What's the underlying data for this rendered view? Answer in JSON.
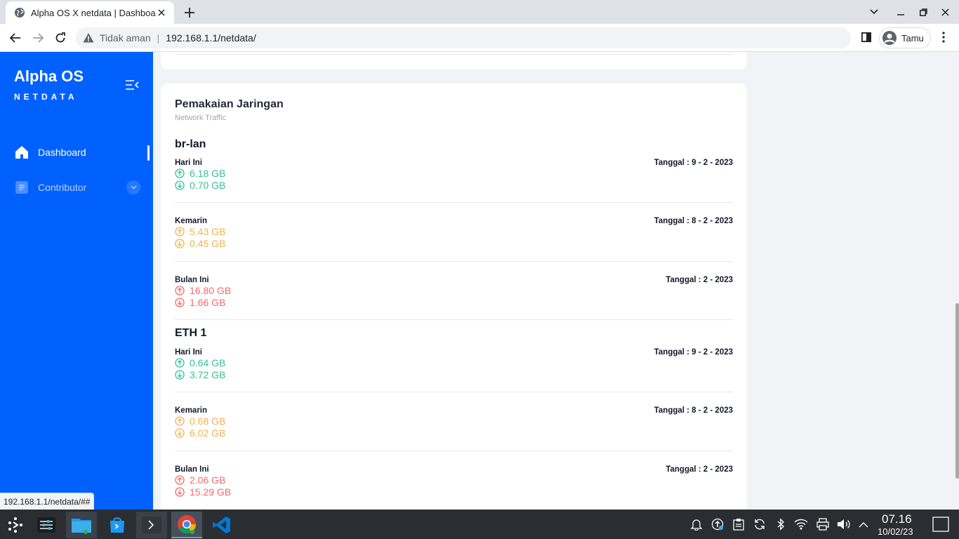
{
  "browser": {
    "tab_title": "Alpha OS X netdata | Dashboard",
    "insecure_label": "Tidak aman",
    "url": "192.168.1.1/netdata/",
    "profile_name": "Tamu",
    "status_url": "192.168.1.1/netdata/##"
  },
  "sidebar": {
    "brand_title": "Alpha OS",
    "brand_subtitle": "NETDATA",
    "items": [
      {
        "label": "Dashboard",
        "icon": "home-icon",
        "active": true
      },
      {
        "label": "Contributor",
        "icon": "document-icon",
        "active": false
      }
    ]
  },
  "card": {
    "title": "Pemakaian Jaringan",
    "subtitle": "Network Traffic"
  },
  "interfaces": [
    {
      "name": "br-lan",
      "periods": [
        {
          "label": "Hari Ini",
          "date": "Tanggal : 9 - 2 - 2023",
          "up": "6.18 GB",
          "down": "0.70 GB",
          "color": "#34c38f"
        },
        {
          "label": "Kemarin",
          "date": "Tanggal : 8 - 2 - 2023",
          "up": "5.43 GB",
          "down": "0.45 GB",
          "color": "#f1b44c"
        },
        {
          "label": "Bulan Ini",
          "date": "Tanggal : 2 - 2023",
          "up": "16.80 GB",
          "down": "1.66 GB",
          "color": "#f46a6a"
        }
      ]
    },
    {
      "name": "ETH 1",
      "periods": [
        {
          "label": "Hari Ini",
          "date": "Tanggal : 9 - 2 - 2023",
          "up": "0.64 GB",
          "down": "3.72 GB",
          "color": "#34c38f"
        },
        {
          "label": "Kemarin",
          "date": "Tanggal : 8 - 2 - 2023",
          "up": "0.68 GB",
          "down": "6.02 GB",
          "color": "#f1b44c"
        },
        {
          "label": "Bulan Ini",
          "date": "Tanggal : 2 - 2023",
          "up": "2.06 GB",
          "down": "15.29 GB",
          "color": "#f46a6a"
        }
      ]
    }
  ],
  "taskbar": {
    "time": "07.16",
    "date": "10/02/23"
  },
  "colors": {
    "sidebar_bg": "#0061fe",
    "today": "#34c38f",
    "yesterday": "#f1b44c",
    "month": "#f46a6a"
  }
}
